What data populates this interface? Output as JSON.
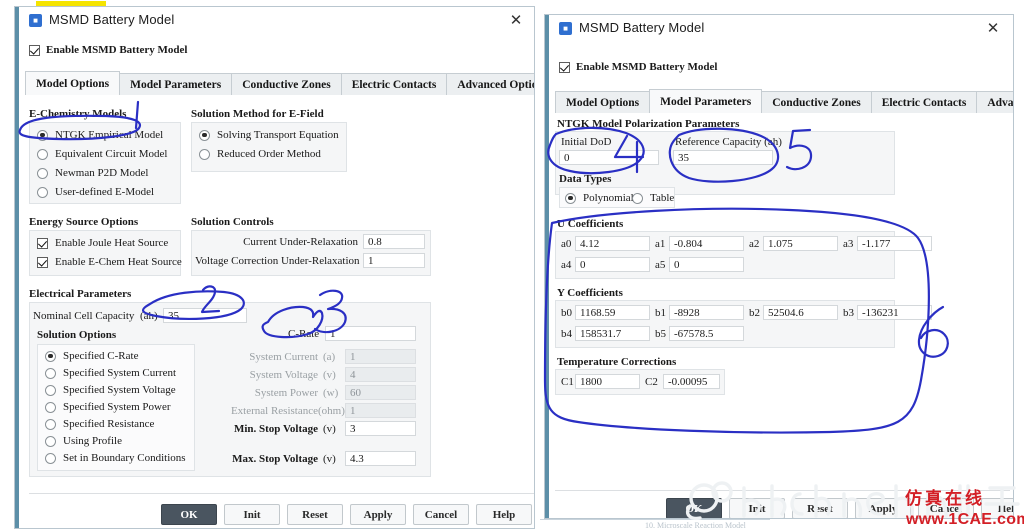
{
  "left_dialog": {
    "title": "MSMD Battery Model",
    "close_label": "✕",
    "enable_label": "Enable MSMD Battery Model",
    "enable_checked": true,
    "tabs": [
      {
        "label": "Model Options",
        "active": true
      },
      {
        "label": "Model Parameters",
        "active": false
      },
      {
        "label": "Conductive Zones",
        "active": false
      },
      {
        "label": "Electric Contacts",
        "active": false
      },
      {
        "label": "Advanced Option",
        "active": false
      }
    ],
    "echem_group_title": "E-Chemistry Models",
    "echem_options": [
      {
        "label": "NTGK Empirical Model",
        "selected": true
      },
      {
        "label": "Equivalent Circuit Model",
        "selected": false
      },
      {
        "label": "Newman P2D Model",
        "selected": false
      },
      {
        "label": "User-defined E-Model",
        "selected": false
      }
    ],
    "solution_method_title": "Solution Method for E-Field",
    "solution_method_options": [
      {
        "label": "Solving Transport Equation",
        "selected": true
      },
      {
        "label": "Reduced Order Method",
        "selected": false
      }
    ],
    "energy_group_title": "Energy Source Options",
    "energy_options": [
      {
        "label": "Enable Joule Heat Source",
        "checked": true
      },
      {
        "label": "Enable E-Chem Heat Source",
        "checked": true
      }
    ],
    "solution_controls_title": "Solution Controls",
    "solution_controls": [
      {
        "label": "Current Under-Relaxation",
        "value": "0.8"
      },
      {
        "label": "Voltage Correction Under-Relaxation",
        "value": "1"
      }
    ],
    "electrical_group_title": "Electrical Parameters",
    "nominal_capacity": {
      "label": "Nominal Cell Capacity",
      "unit": "(ah)",
      "value": "35"
    },
    "crate": {
      "label": "C-Rate",
      "value": "1"
    },
    "solution_options_title": "Solution Options",
    "solution_options": [
      {
        "label": "Specified C-Rate",
        "selected": true
      },
      {
        "label": "Specified System Current",
        "selected": false
      },
      {
        "label": "Specified System Voltage",
        "selected": false
      },
      {
        "label": "Specified System Power",
        "selected": false
      },
      {
        "label": "Specified Resistance",
        "selected": false
      },
      {
        "label": "Using Profile",
        "selected": false
      },
      {
        "label": "Set in Boundary Conditions",
        "selected": false
      }
    ],
    "right_fields": [
      {
        "label": "System Current",
        "unit": "(a)",
        "value": "1",
        "disabled": true
      },
      {
        "label": "System Voltage",
        "unit": "(v)",
        "value": "4",
        "disabled": true
      },
      {
        "label": "System Power",
        "unit": "(w)",
        "value": "60",
        "disabled": true
      },
      {
        "label": "External Resistance",
        "unit": "(ohm)",
        "value": "1",
        "disabled": true
      },
      {
        "label": "Min. Stop Voltage",
        "unit": "(v)",
        "value": "3",
        "disabled": false
      },
      {
        "label": "Max. Stop Voltage",
        "unit": "(v)",
        "value": "4.3",
        "disabled": false
      }
    ],
    "buttons": [
      "OK",
      "Init",
      "Reset",
      "Apply",
      "Cancel",
      "Help"
    ]
  },
  "right_dialog": {
    "title": "MSMD Battery Model",
    "close_label": "✕",
    "enable_label": "Enable MSMD Battery Model",
    "enable_checked": true,
    "tabs": [
      {
        "label": "Model Options",
        "active": false
      },
      {
        "label": "Model Parameters",
        "active": true
      },
      {
        "label": "Conductive Zones",
        "active": false
      },
      {
        "label": "Electric Contacts",
        "active": false
      },
      {
        "label": "Advanced Option",
        "active": false
      }
    ],
    "section_title": "NTGK Model Polarization Parameters",
    "initial_dod": {
      "label": "Initial DoD",
      "value": "0"
    },
    "reference_capacity": {
      "label": "Reference Capacity (ah)",
      "value": "35"
    },
    "data_types_title": "Data Types",
    "data_types": [
      {
        "label": "Polynomial",
        "selected": true
      },
      {
        "label": "Table",
        "selected": false
      }
    ],
    "u_coefficients_title": "U Coefficients",
    "u_coefficients": [
      {
        "name": "a0",
        "value": "4.12"
      },
      {
        "name": "a1",
        "value": "-0.804"
      },
      {
        "name": "a2",
        "value": "1.075"
      },
      {
        "name": "a3",
        "value": "-1.177"
      },
      {
        "name": "a4",
        "value": "0"
      },
      {
        "name": "a5",
        "value": "0"
      }
    ],
    "y_coefficients_title": "Y Coefficients",
    "y_coefficients": [
      {
        "name": "b0",
        "value": "1168.59"
      },
      {
        "name": "b1",
        "value": "-8928"
      },
      {
        "name": "b2",
        "value": "52504.6"
      },
      {
        "name": "b3",
        "value": "-136231"
      },
      {
        "name": "b4",
        "value": "158531.7"
      },
      {
        "name": "b5",
        "value": "-67578.5"
      }
    ],
    "temperature_title": "Temperature Corrections",
    "temperature": [
      {
        "name": "C1",
        "value": "1800"
      },
      {
        "name": "C2",
        "value": "-0.00095"
      }
    ],
    "buttons": [
      "OK",
      "Init",
      "Reset",
      "Apply",
      "Cancel",
      "Help"
    ]
  },
  "annotations": {
    "color": "#2a2fc4",
    "marks": [
      {
        "number": "1",
        "target": "NTGK Empirical Model radio"
      },
      {
        "number": "2",
        "target": "Nominal Cell Capacity field"
      },
      {
        "number": "3",
        "target": "C-Rate field"
      },
      {
        "number": "4",
        "target": "Initial DoD field"
      },
      {
        "number": "5",
        "target": "Reference Capacity field"
      },
      {
        "number": "6",
        "target": "Coefficients block"
      }
    ]
  },
  "watermarks": {
    "faint": "1CAE.C",
    "handle": "Workbench小学生",
    "cn": "仿真在线",
    "site": "www.1CAE.com",
    "ghost_caption": "10. Microscale Reaction Model"
  }
}
